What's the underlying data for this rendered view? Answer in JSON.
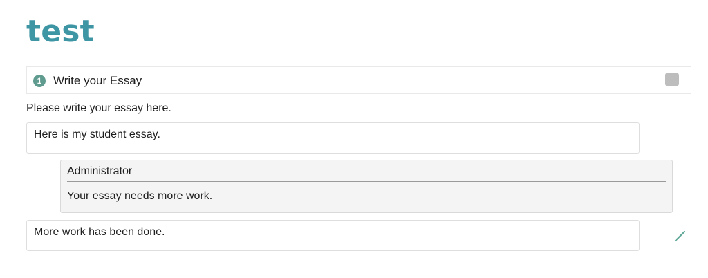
{
  "page": {
    "title": "test"
  },
  "step": {
    "number": "1",
    "title": "Write your Essay"
  },
  "instructions": "Please write your essay here.",
  "submissions": [
    {
      "text": "Here is my student essay."
    },
    {
      "text": "More work has been done."
    }
  ],
  "feedback": {
    "author": "Administrator",
    "comment": "Your essay needs more work."
  },
  "icons": {
    "edit": "pencil-icon"
  },
  "colors": {
    "title": "#3e96a5",
    "step_badge": "#5f9b8f",
    "toggle": "#bdbdbd",
    "feedback_bg": "#f4f4f4",
    "edit_icon": "#5fa898"
  }
}
